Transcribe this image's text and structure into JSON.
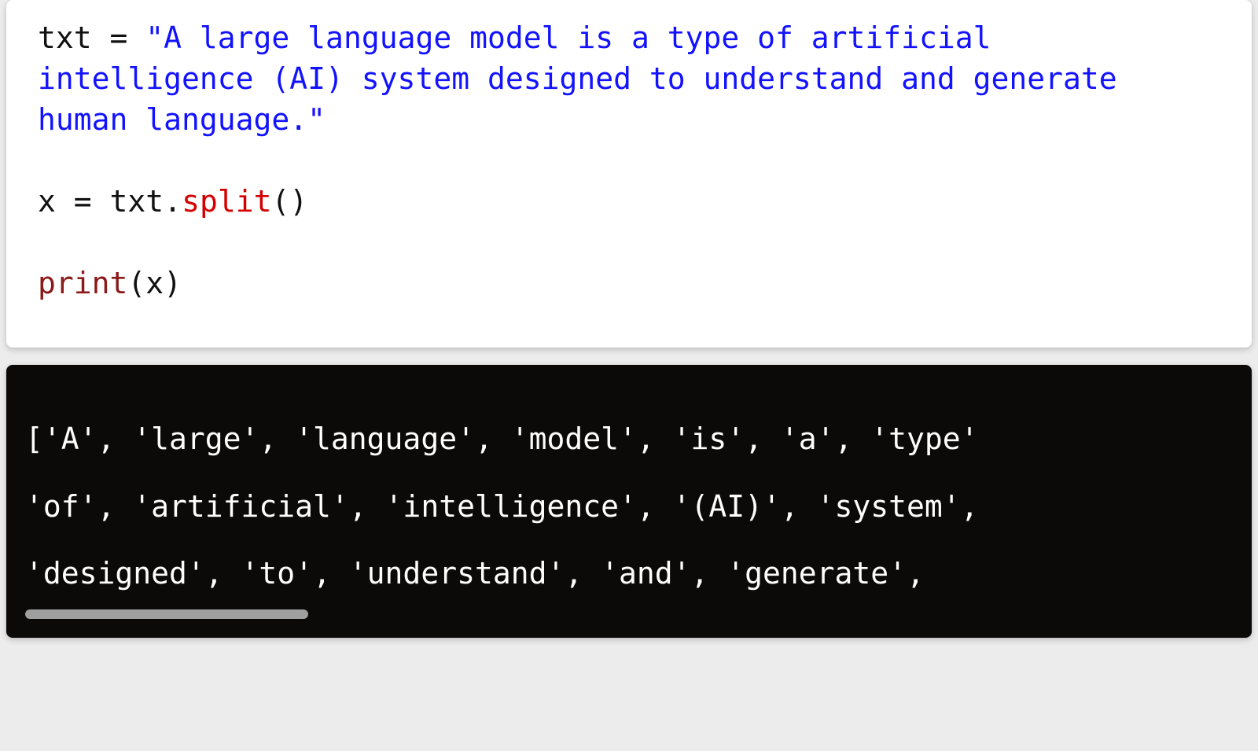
{
  "code": {
    "var_txt": "txt",
    "assign": " = ",
    "string_literal": "\"A large language model is a type of artificial intelligence (AI) system designed to understand and generate human language.\"",
    "var_x": "x",
    "txt_ref": "txt",
    "dot": ".",
    "method_split": "split",
    "call_parens": "()",
    "func_print": "print",
    "open_paren": "(",
    "arg_x": "x",
    "close_paren": ")"
  },
  "output": {
    "line1": " ['A', 'large', 'language', 'model', 'is', 'a', 'type'",
    "line2": "'of', 'artificial', 'intelligence', '(AI)', 'system',",
    "line3": "'designed', 'to', 'understand', 'and', 'generate',"
  },
  "colors": {
    "page_bg": "#ececec",
    "code_bg": "#ffffff",
    "output_bg": "#0c0a09",
    "output_fg": "#fefefe",
    "string_color": "#1212ff",
    "call_color": "#d40000",
    "func_color": "#8b1a1a",
    "scrollbar_thumb": "#9f9f9f"
  }
}
